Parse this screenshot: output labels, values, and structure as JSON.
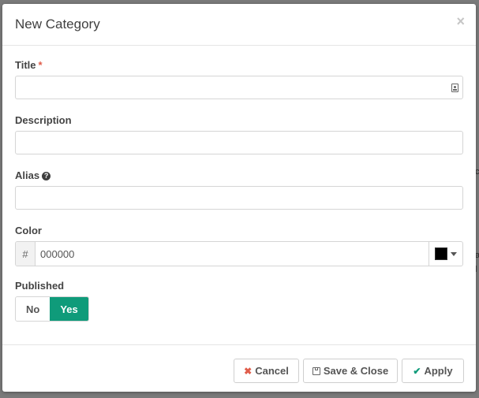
{
  "background": {
    "fragments": [
      "c",
      "a",
      "l"
    ]
  },
  "dialog": {
    "title": "New Category",
    "close_glyph": "×",
    "close_icon": "close-icon"
  },
  "fields": {
    "title": {
      "label": "Title",
      "required_mark": "*",
      "value": "",
      "placeholder": "",
      "addon_icon": "id-card-icon"
    },
    "description": {
      "label": "Description",
      "value": "",
      "placeholder": ""
    },
    "alias": {
      "label": "Alias",
      "help_glyph": "?",
      "help_icon": "question-circle-icon",
      "value": "",
      "placeholder": ""
    },
    "color": {
      "label": "Color",
      "prefix": "#",
      "value": "000000",
      "swatch_color": "#000000"
    },
    "published": {
      "label": "Published",
      "options": [
        "No",
        "Yes"
      ],
      "selected": "Yes"
    }
  },
  "footer": {
    "cancel_label": "Cancel",
    "cancel_glyph": "✖",
    "save_close_label": "Save & Close",
    "apply_label": "Apply",
    "apply_glyph": "✔"
  },
  "colors": {
    "accent": "#0f9b7a",
    "required": "#e05d4b"
  }
}
